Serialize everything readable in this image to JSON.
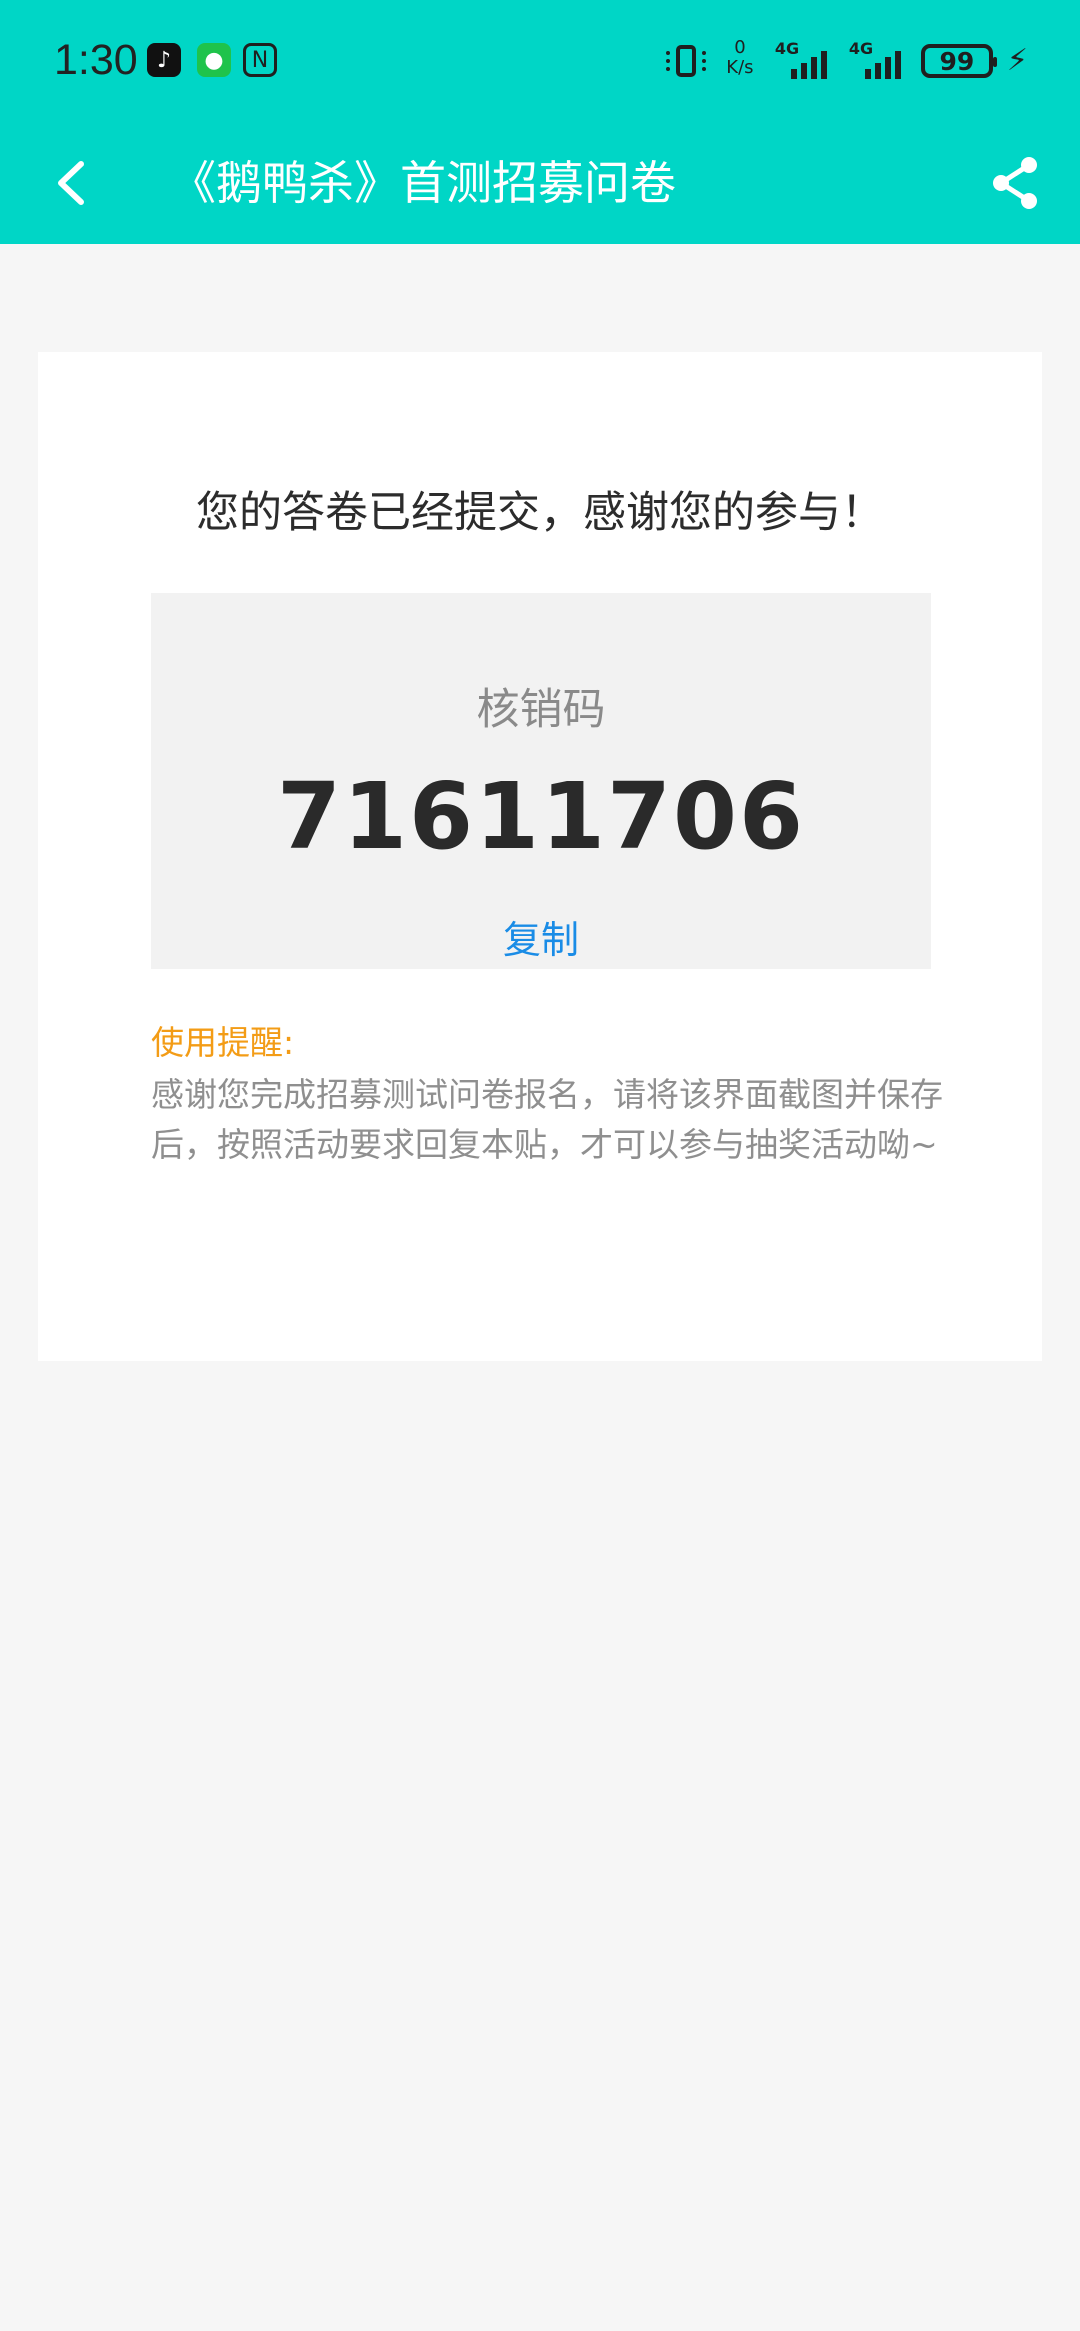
{
  "status_bar": {
    "time": "1:30",
    "apps": [
      "tiktok-icon",
      "wechat-icon",
      "nfc-icon"
    ],
    "speed_value": "0",
    "speed_unit": "K/s",
    "network_1": "4G",
    "network_2": "4G",
    "battery": "99"
  },
  "app_bar": {
    "title": "《鹅鸭杀》首测招募问卷"
  },
  "card": {
    "thanks": "您的答卷已经提交，感谢您的参与！",
    "code_label": "核销码",
    "code_value": "71611706",
    "copy_label": "复制",
    "reminder_title": "使用提醒:",
    "reminder_body": "感谢您完成招募测试问卷报名，请将该界面截图并保存后，按照活动要求回复本贴，才可以参与抽奖活动呦~"
  },
  "colors": {
    "accent": "#00d6c6",
    "link": "#1a8ce6",
    "warning": "#f39c16"
  }
}
